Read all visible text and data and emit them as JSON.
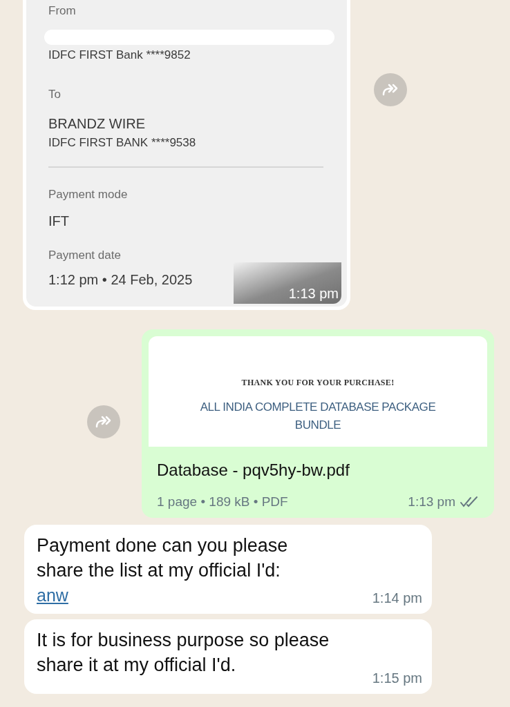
{
  "messages": [
    {
      "kind": "receipt",
      "from_label": "From",
      "from_name_redacted": true,
      "from_bank": "IDFC FIRST Bank ****9852",
      "to_label": "To",
      "to_name": "BRANDZ WIRE",
      "to_bank": "IDFC FIRST BANK ****9538",
      "mode_label": "Payment mode",
      "mode": "IFT",
      "date_label": "Payment date",
      "date": "1:12 pm • 24 Feb, 2025",
      "time": "1:13 pm"
    },
    {
      "kind": "document",
      "preview_heading": "THANK YOU FOR YOUR PURCHASE!",
      "preview_title": "ALL INDIA COMPLETE DATABASE PACKAGE BUNDLE",
      "file_name": "Database - pqv5hy-bw.pdf",
      "file_meta": "1 page • 189 kB • PDF",
      "time": "1:13 pm",
      "read": false
    },
    {
      "kind": "text",
      "lines": [
        "Payment done can you please",
        "share the list at my official I'd:"
      ],
      "link": "anw",
      "time": "1:14 pm"
    },
    {
      "kind": "text",
      "lines": [
        "It is for business purpose so please",
        "share it at my official I'd."
      ],
      "time": "1:15 pm"
    }
  ]
}
